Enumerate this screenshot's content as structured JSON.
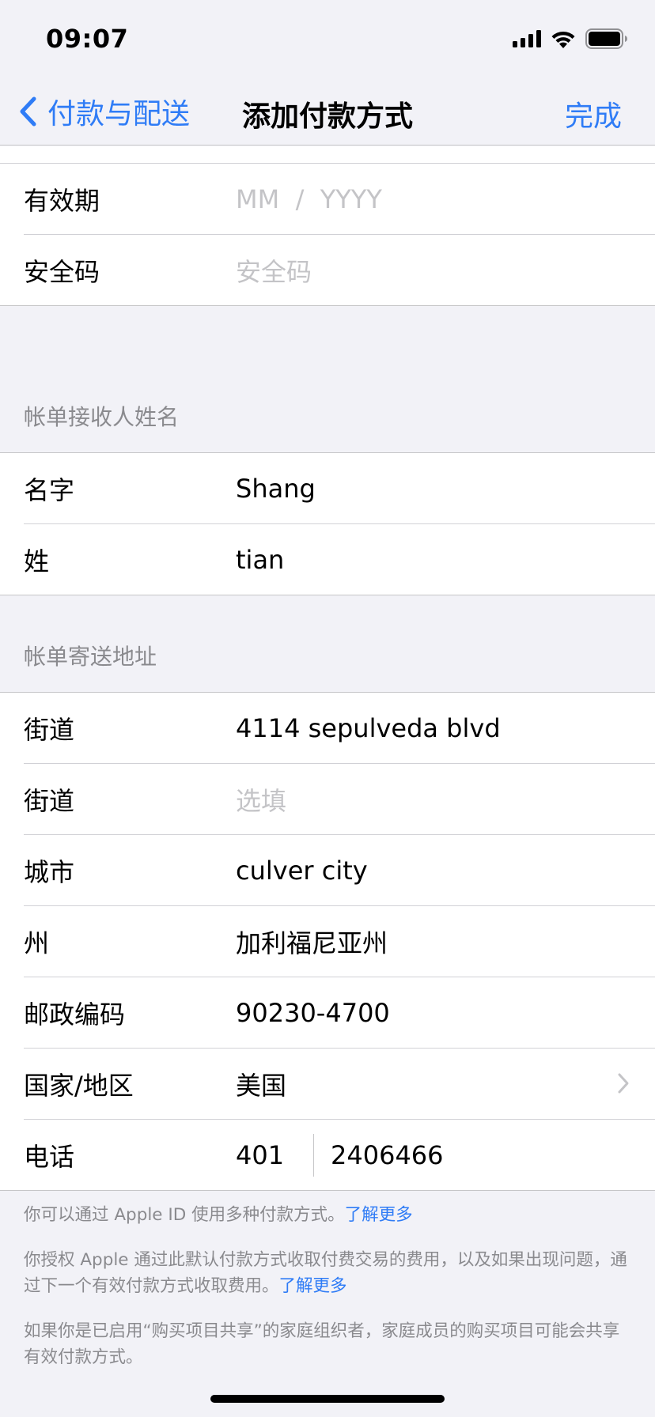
{
  "status_bar": {
    "time": "09:07",
    "icons": [
      "cellular-signal-icon",
      "wifi-icon",
      "battery-icon"
    ]
  },
  "nav": {
    "back_label": "付款与配送",
    "title": "添加付款方式",
    "done_label": "完成"
  },
  "card": {
    "expiry_label": "有效期",
    "expiry_placeholder": "MM  /  YYYY",
    "cvv_label": "安全码",
    "cvv_placeholder": "安全码"
  },
  "billing_name": {
    "header": "帐单接收人姓名",
    "first_label": "名字",
    "first_value": "Shang",
    "last_label": "姓",
    "last_value": "tian"
  },
  "billing_address": {
    "header": "帐单寄送地址",
    "street1_label": "街道",
    "street1_value": "4114 sepulveda blvd",
    "street2_label": "街道",
    "street2_placeholder": "选填",
    "city_label": "城市",
    "city_value": "culver city",
    "state_label": "州",
    "state_value": "加利福尼亚州",
    "zip_label": "邮政编码",
    "zip_value": "90230-4700",
    "country_label": "国家/地区",
    "country_value": "美国",
    "phone_label": "电话",
    "phone_area": "401",
    "phone_number": "2406466"
  },
  "footer": {
    "p1_text": "你可以通过 Apple ID 使用多种付款方式。",
    "p1_link": "了解更多",
    "p2_text": "你授权 Apple 通过此默认付款方式收取付费交易的费用，以及如果出现问题，通过下一个有效付款方式收取费用。",
    "p2_link": "了解更多",
    "p3_text": "如果你是已启用“购买项目共享”的家庭组织者，家庭成员的购买项目可能会共享有效付款方式。"
  },
  "colors": {
    "accent": "#2f7cf6",
    "background": "#f2f2f7",
    "secondary_text": "#8a8a8e",
    "placeholder": "#c4c4c7"
  }
}
